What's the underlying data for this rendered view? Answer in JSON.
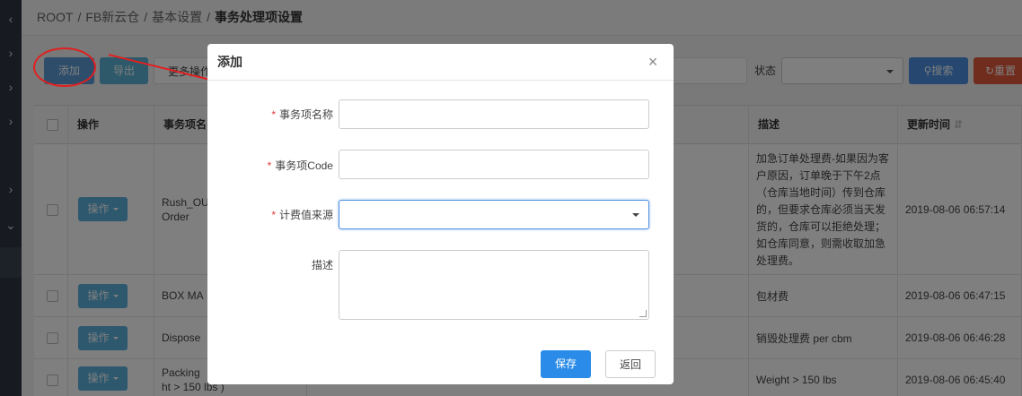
{
  "sidebar": {
    "items": [
      {
        "icon": "chevron-left-icon"
      },
      {
        "icon": "chevron-right-icon"
      },
      {
        "icon": "chevron-right-icon"
      },
      {
        "icon": "chevron-right-icon"
      },
      {
        "icon": "chevron-right-icon"
      },
      {
        "icon": "chevron-down-icon"
      }
    ]
  },
  "breadcrumb": {
    "items": [
      "ROOT",
      "FB新云仓",
      "基本设置"
    ],
    "current": "事务处理项设置",
    "sep": "/"
  },
  "toolbar": {
    "add_label": "添加",
    "export_label": "导出",
    "more_label": "更多操作",
    "status_label": "状态",
    "search_label": "搜索",
    "reset_label": "重置"
  },
  "table": {
    "headers": [
      "操作",
      "事务项名",
      "描述",
      "更新时间"
    ],
    "op_label": "操作",
    "rows": [
      {
        "name": "Rush_Order",
        "name_line1": "Rush_OU",
        "name_line2": "Order",
        "desc": "加急订单处理费-如果因为客户原因，订单晚于下午2点（仓库当地时间）传到仓库的，但要求仓库必须当天发货的，仓库可以拒绝处理；如仓库同意，则需收取加急处理费。",
        "time": "2019-08-06 06:57:14"
      },
      {
        "name": "BOX MA",
        "desc": "包材费",
        "time": "2019-08-06 06:47:15"
      },
      {
        "name": "Dispose",
        "desc": "销毁处理费 per cbm",
        "time": "2019-08-06 06:46:28"
      },
      {
        "name_line1": "Packing",
        "name_line2": "ht > 150 lbs )",
        "desc": "Weight > 150 lbs",
        "time": "2019-08-06 06:45:40"
      }
    ]
  },
  "modal": {
    "title": "添加",
    "close_label": "×",
    "required_mark": "*",
    "fields": {
      "name_label": "事务项名称",
      "code_label": "事务项Code",
      "source_label": "计费值来源",
      "desc_label": "描述"
    },
    "save_label": "保存",
    "back_label": "返回"
  },
  "colors": {
    "primary": "#2b8be8",
    "danger": "#e05a3a",
    "annotation": "#e02020"
  }
}
